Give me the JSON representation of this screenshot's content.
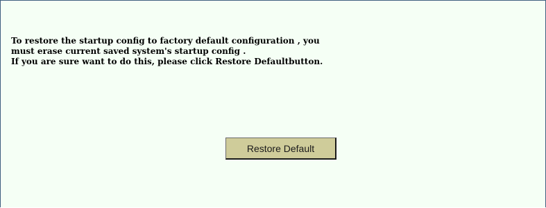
{
  "message": {
    "lines": [
      "To restore the startup config to factory default configuration , you",
      "must erase current saved system's startup config .",
      "If you are sure want to do this, please click Restore Defaultbutton."
    ]
  },
  "actions": {
    "restore_default_label": "Restore Default"
  },
  "colors": {
    "panel_background": "#f5fff5",
    "panel_border": "#3f5f7f",
    "button_background": "#cfcc9a"
  }
}
